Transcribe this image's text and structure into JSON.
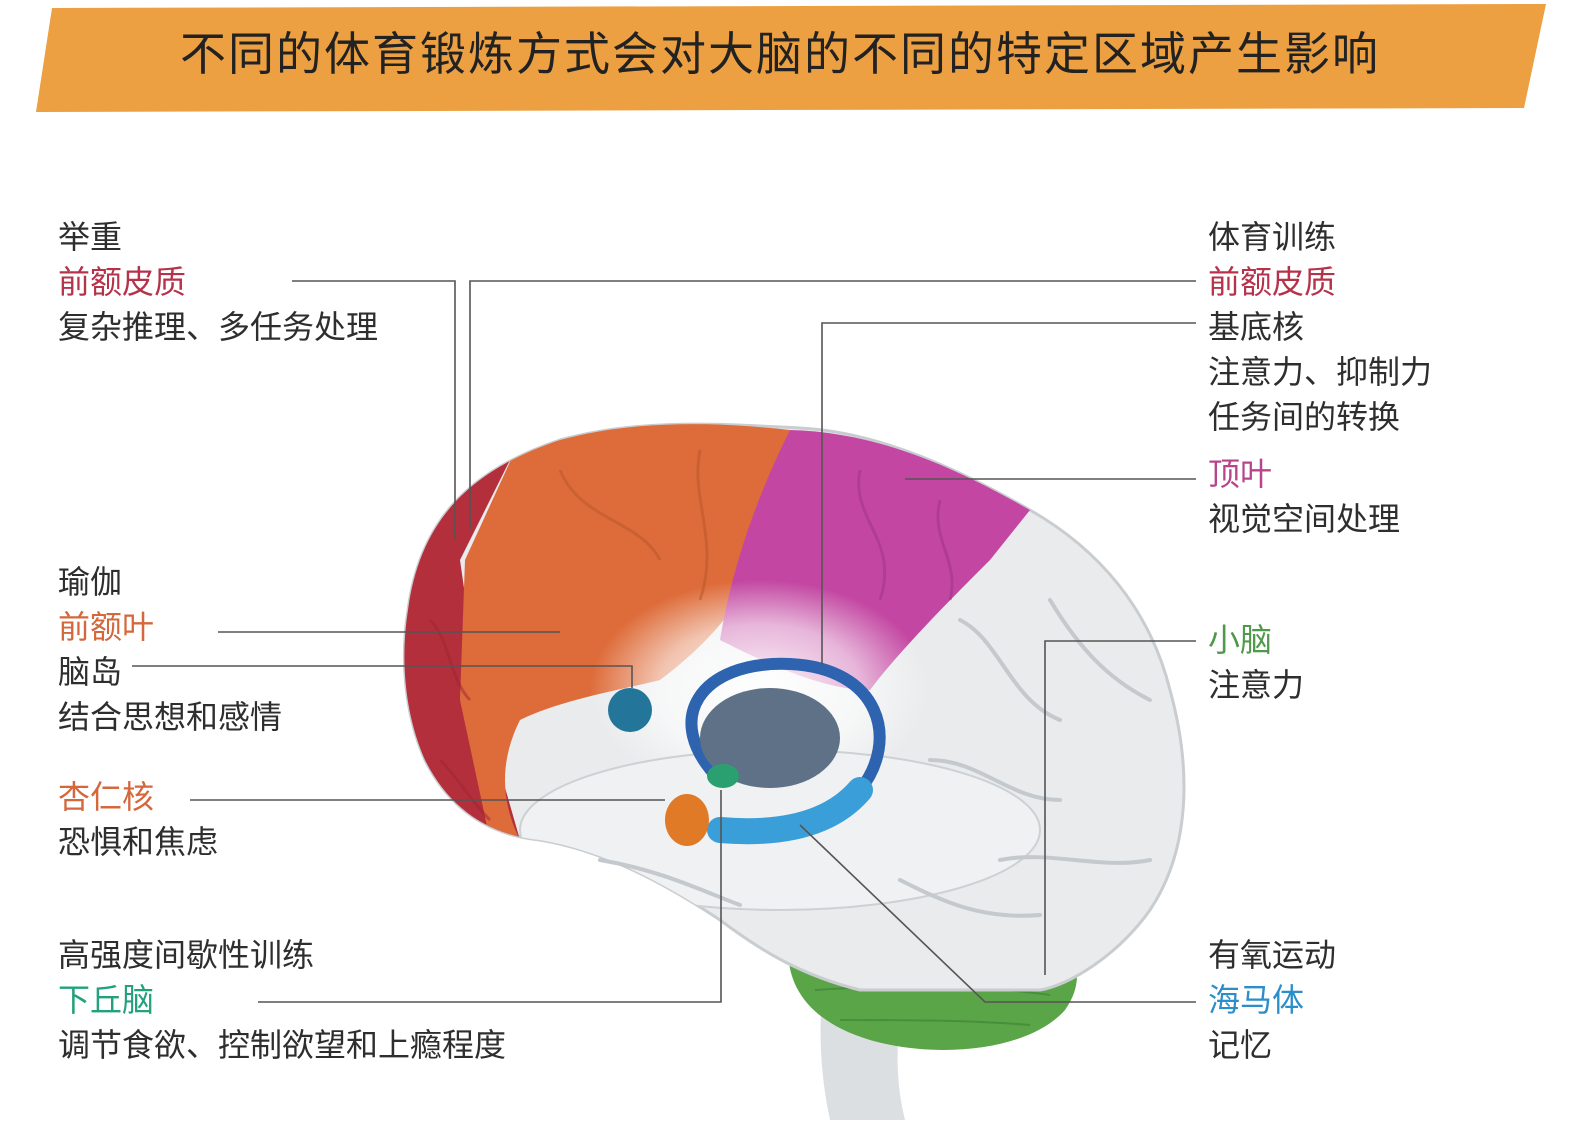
{
  "title": "不同的体育锻炼方式会对大脑的不同的特定区域产生影响",
  "colors": {
    "banner": "#eca042",
    "prefrontal_cortex": "#b42f3c",
    "frontal_lobe": "#de6c3a",
    "parietal_lobe": "#c347a2",
    "insula": "#23769a",
    "basal_ganglia": "#2e63b0",
    "hippocampus": "#3a9fd8",
    "hypothalamus": "#2aa070",
    "amygdala": "#e07a27",
    "cerebellum": "#5aa548",
    "brain_base": "#e9ebec"
  },
  "labels": {
    "weights": {
      "activity": "举重",
      "region": "前额皮质",
      "function": "复杂推理、多任务处理"
    },
    "sports": {
      "activity": "体育训练",
      "region": "前额皮质",
      "region2": "基底核",
      "function1": "注意力、抑制力",
      "function2": "任务间的转换"
    },
    "parietal": {
      "region": "顶叶",
      "function": "视觉空间处理"
    },
    "yoga": {
      "activity": "瑜伽",
      "region": "前额叶",
      "region2": "脑岛",
      "function": "结合思想和感情"
    },
    "amygdala": {
      "region": "杏仁核",
      "function": "恐惧和焦虑"
    },
    "cerebellum": {
      "region": "小脑",
      "function": "注意力"
    },
    "hiit": {
      "activity": "高强度间歇性训练",
      "region": "下丘脑",
      "function": "调节食欲、控制欲望和上瘾程度"
    },
    "aerobic": {
      "activity": "有氧运动",
      "region": "海马体",
      "function": "记忆"
    }
  }
}
